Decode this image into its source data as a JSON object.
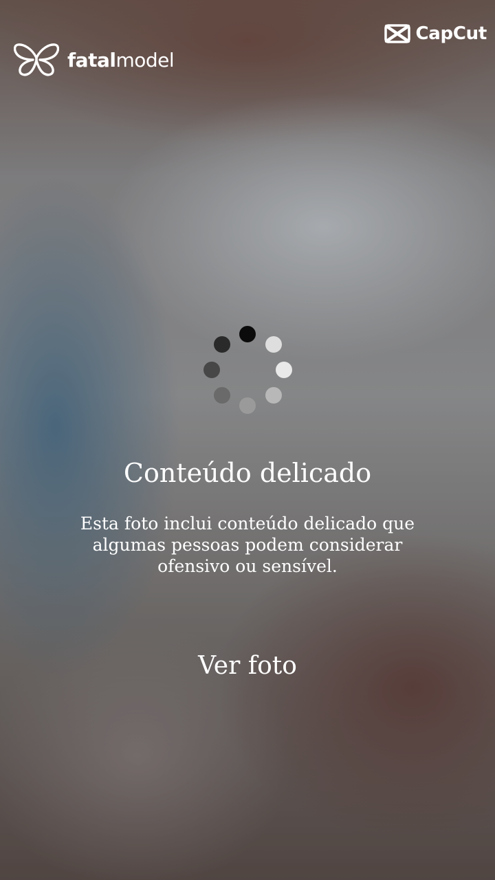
{
  "brand": {
    "name_bold": "fatal",
    "name_light": "model",
    "logo_icon": "butterfly-icon"
  },
  "watermark": {
    "label": "CapCut",
    "icon": "capcut-logo-icon"
  },
  "spinner": {
    "icon": "loading-spinner-icon",
    "state": "loading"
  },
  "overlay": {
    "title": "Conteúdo delicado",
    "description": "Esta foto inclui conteúdo delicado que algumas pessoas podem considerar ofensivo ou sensível.",
    "action_label": "Ver foto"
  },
  "colors": {
    "text": "#ffffff"
  }
}
